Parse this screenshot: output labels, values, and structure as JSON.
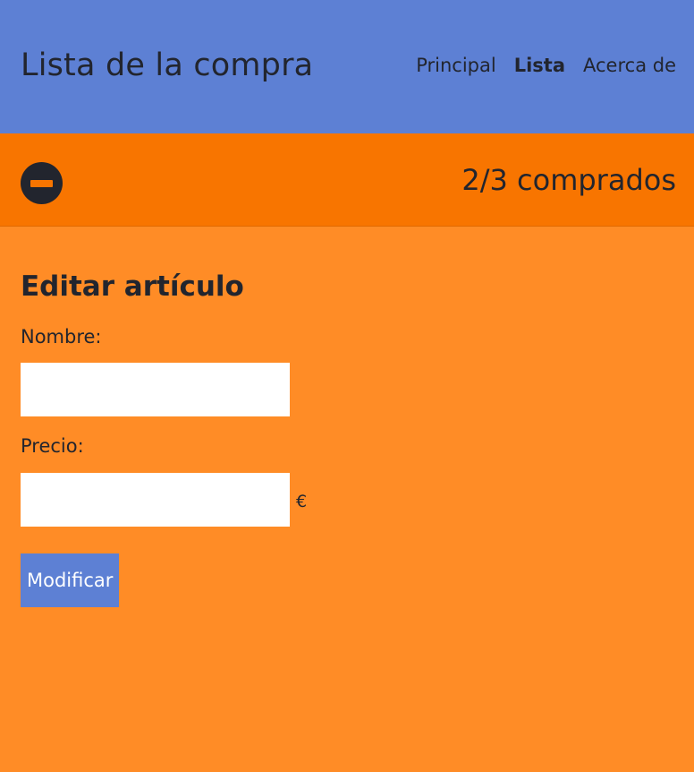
{
  "header": {
    "title": "Lista de la compra",
    "nav": [
      {
        "label": "Principal",
        "active": false
      },
      {
        "label": "Lista",
        "active": true
      },
      {
        "label": "Acerca de",
        "active": false
      }
    ]
  },
  "status": {
    "toggle_icon": "minus-circle-icon",
    "text": "2/3 comprados"
  },
  "form": {
    "title": "Editar artículo",
    "name_label": "Nombre:",
    "name_value": "",
    "price_label": "Precio:",
    "price_value": "",
    "currency": "€",
    "submit_label": "Modificar"
  },
  "colors": {
    "header_bg": "#5d80d4",
    "status_bg": "#f87500",
    "page_bg": "#ff8c26",
    "button_bg": "#5d80d4",
    "text": "#22252e"
  }
}
